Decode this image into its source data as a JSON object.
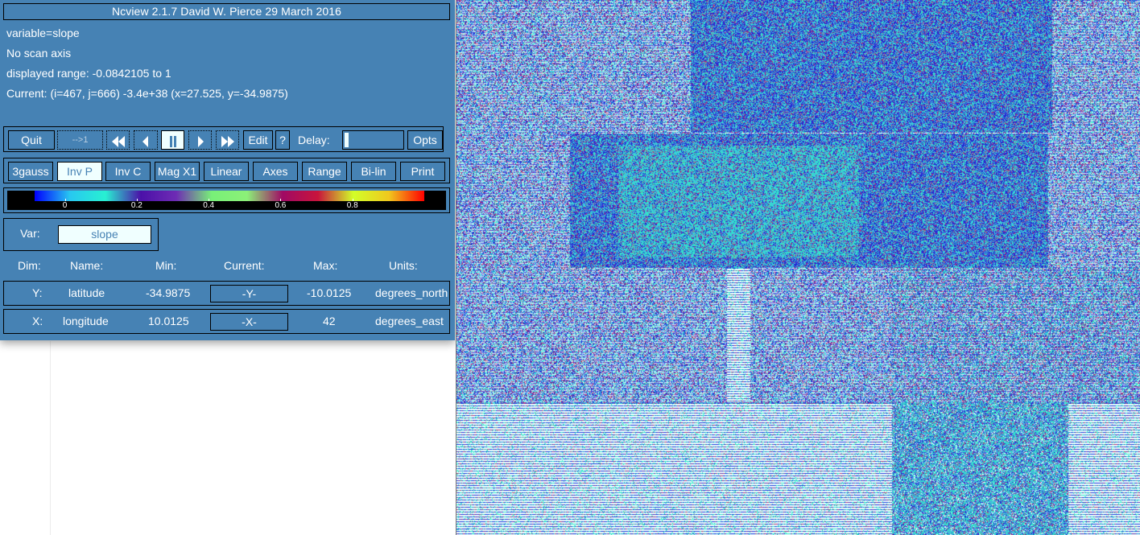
{
  "window": {
    "title": "Ncview 2.1.7 David W. Pierce  29 March 2016"
  },
  "info": {
    "variable": "variable=slope",
    "scan_axis": "No scan axis",
    "displayed_range": "displayed range: -0.0842105 to 1",
    "current": "Current: (i=467, j=666) -3.4e+38 (x=27.525, y=-34.9875)"
  },
  "toolbar1": {
    "quit": "Quit",
    "restart": "-->1",
    "rewind_icon": "fast-rewind-icon",
    "back_icon": "step-back-icon",
    "pause_icon": "pause-icon",
    "forward_icon": "step-forward-icon",
    "fastforward_icon": "fast-forward-icon",
    "edit": "Edit",
    "help": "?",
    "delay_label": "Delay:",
    "delay_value": 0,
    "opts": "Opts"
  },
  "toolbar2": {
    "buttons": [
      "3gauss",
      "Inv P",
      "Inv C",
      "Mag X1",
      "Linear",
      "Axes",
      "Range",
      "Bi-lin",
      "Print"
    ],
    "active": "Inv P"
  },
  "colorbar": {
    "ticks": [
      "0",
      "0.2",
      "0.4",
      "0.6",
      "0.8"
    ],
    "tick_values": [
      0,
      0.2,
      0.4,
      0.6,
      0.8
    ],
    "range": [
      -0.0842105,
      1
    ],
    "colors": [
      "#0000ff",
      "#28c8f0",
      "#28f0d2",
      "#4b10a8",
      "#6e2cb4",
      "#78f078",
      "#8cf078",
      "#a00a64",
      "#c8143c",
      "#d2ff28",
      "#f0c81e",
      "#ff0000"
    ]
  },
  "var_selector": {
    "label": "Var:",
    "value": "slope"
  },
  "dims": {
    "headers": [
      "Dim:",
      "Name:",
      "Min:",
      "Current:",
      "Max:",
      "Units:"
    ],
    "rows": [
      {
        "dim": "Y:",
        "name": "latitude",
        "min": "-34.9875",
        "current": "-Y-",
        "max": "-10.0125",
        "units": "degrees_north"
      },
      {
        "dim": "X:",
        "name": "longitude",
        "min": "10.0125",
        "current": "-X-",
        "max": "42",
        "units": "degrees_east"
      }
    ]
  },
  "image": {
    "palette": [
      "#1e3cdc",
      "#2828d2",
      "#3cc8e6",
      "#32e6c8",
      "#6e2cb4",
      "#b43c78",
      "#f0ffff",
      "#ffffff",
      "#50a0e6"
    ]
  }
}
